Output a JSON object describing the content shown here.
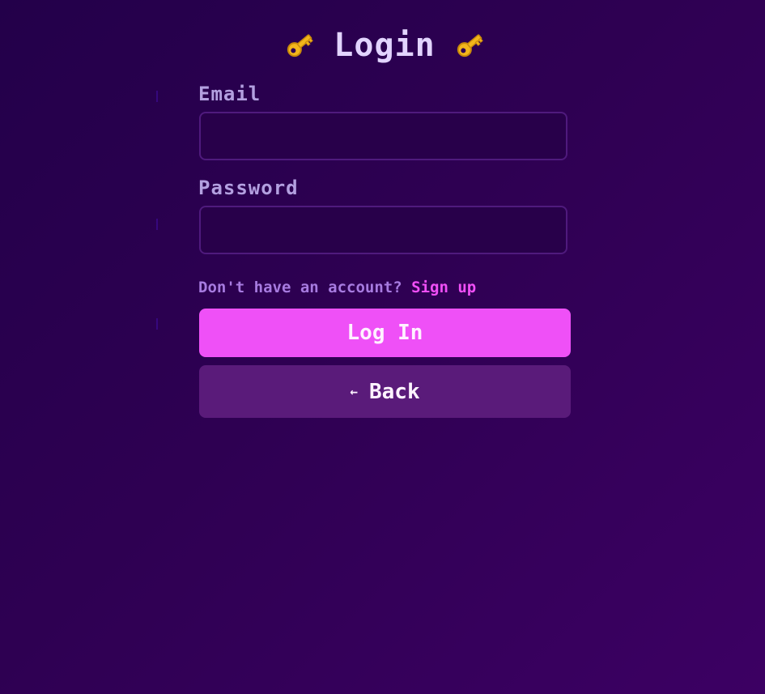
{
  "header": {
    "title": "Login",
    "left_icon": "key-icon",
    "right_icon": "key-icon"
  },
  "form": {
    "email_label": "Email",
    "email_value": "",
    "email_placeholder": "",
    "password_label": "Password",
    "password_value": "",
    "password_placeholder": ""
  },
  "signup": {
    "prompt": "Don't have an account?",
    "link_label": "Sign up"
  },
  "buttons": {
    "login_label": "Log In",
    "back_arrow": "←",
    "back_label": "Back"
  },
  "colors": {
    "background": "#2e0052",
    "accent": "#ef50f7",
    "secondary_button": "#5a1b7a",
    "label": "#b3a0e0"
  }
}
